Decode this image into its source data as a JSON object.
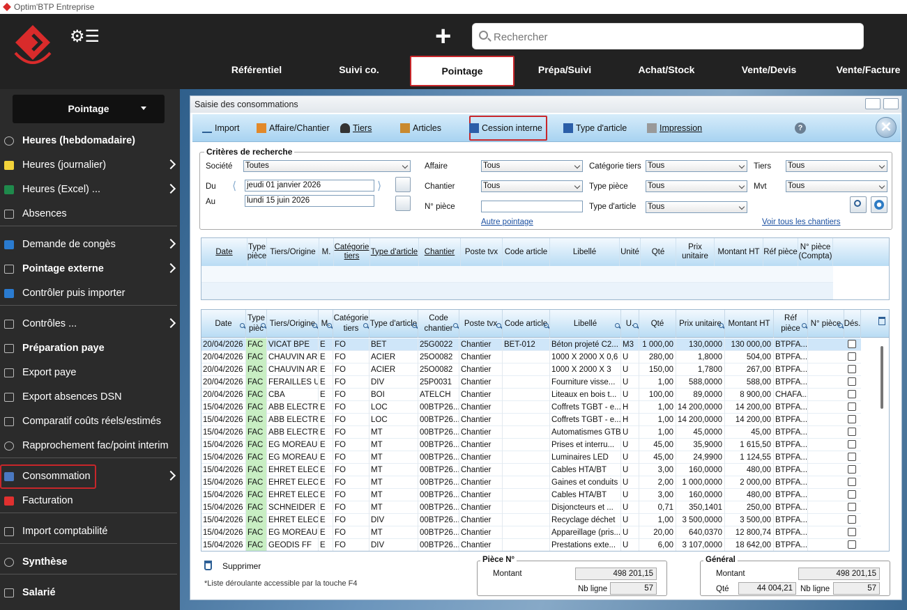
{
  "app_title": "Optim'BTP Entreprise",
  "search": {
    "placeholder": "Rechercher"
  },
  "nav": [
    "Référentiel",
    "Suivi co.",
    "Pointage",
    "Prépa/Suivi",
    "Achat/Stock",
    "Vente/Devis",
    "Vente/Facture"
  ],
  "nav_active": "Pointage",
  "sidebar": {
    "selector": "Pointage",
    "items": [
      {
        "label": "Heures (hebdomadaire)",
        "bold": true,
        "arrow": false,
        "icon": "clock-icon"
      },
      {
        "label": "Heures (journalier)",
        "bold": false,
        "arrow": true,
        "icon": "calendar-yellow-icon"
      },
      {
        "label": "Heures (Excel) ...",
        "bold": false,
        "arrow": true,
        "icon": "excel-icon"
      },
      {
        "label": "Absences",
        "bold": false,
        "arrow": false,
        "icon": "calendar-25-icon"
      },
      {
        "label": "Demande de congès",
        "bold": false,
        "arrow": true,
        "icon": "calendar-blue-icon"
      },
      {
        "label": "Pointage externe",
        "bold": true,
        "arrow": true,
        "icon": "camera-icon"
      },
      {
        "label": "Contrôler puis importer",
        "bold": false,
        "arrow": false,
        "icon": "import-check-icon"
      },
      {
        "label": "Contrôles ...",
        "bold": false,
        "arrow": true,
        "icon": "check-icon"
      },
      {
        "label": "Préparation paye",
        "bold": true,
        "arrow": false,
        "icon": "document-icon"
      },
      {
        "label": "Export paye",
        "bold": false,
        "arrow": false,
        "icon": "book-icon"
      },
      {
        "label": "Export absences DSN",
        "bold": false,
        "arrow": false,
        "icon": "book-icon"
      },
      {
        "label": "Comparatif coûts réels/estimés",
        "bold": false,
        "arrow": false,
        "icon": "grid-icon"
      },
      {
        "label": "Rapprochement fac/point interim",
        "bold": false,
        "arrow": false,
        "icon": "circle-icon"
      },
      {
        "label": "Consommation",
        "bold": false,
        "arrow": true,
        "icon": "box-blue-icon"
      },
      {
        "label": "Facturation",
        "bold": false,
        "arrow": false,
        "icon": "box-red-icon"
      },
      {
        "label": "Import comptabilité",
        "bold": false,
        "arrow": false,
        "icon": "download-icon"
      },
      {
        "label": "Synthèse",
        "bold": true,
        "arrow": false,
        "icon": "pie-chart-icon"
      },
      {
        "label": "Salarié",
        "bold": true,
        "arrow": false,
        "icon": "person-icon"
      }
    ]
  },
  "window": {
    "title": "Saisie des consommations",
    "toolbar": [
      "Import",
      "Affaire/Chantier",
      "Tiers",
      "Articles",
      "Cession interne",
      "Type d'article",
      "Impression"
    ]
  },
  "criteria": {
    "legend": "Critères de recherche",
    "societe_label": "Société",
    "societe": "Toutes",
    "du_label": "Du",
    "du": "jeudi 01 janvier 2026",
    "au_label": "Au",
    "au": "lundi 15 juin 2026",
    "affaire_label": "Affaire",
    "affaire": "Tous",
    "chantier_label": "Chantier",
    "chantier": "Tous",
    "npiece_label": "N° pièce",
    "npiece": "",
    "cattiers_label": "Catégorie tiers",
    "cattiers": "Tous",
    "typepiece_label": "Type pièce",
    "typepiece": "Tous",
    "typearticle_label": "Type d'article",
    "typearticle": "Tous",
    "tiers_label": "Tiers",
    "tiers": "Tous",
    "mvt_label": "Mvt",
    "mvt": "Tous",
    "autre_pointage": "Autre pointage",
    "voir_chantiers": "Voir tous les chantiers"
  },
  "grid1_headers": [
    "Date",
    "Type pièce",
    "Tiers/Origine",
    "M.",
    "Catégorie tiers",
    "Type d'article",
    "Chantier",
    "Poste tvx",
    "Code article",
    "Libellé",
    "Unité",
    "Qté",
    "Prix unitaire",
    "Montant HT",
    "Réf pièce",
    "N° pièce (Compta)"
  ],
  "grid2_headers": [
    "Date",
    "Type pièc",
    "Tiers/Origine",
    "M.",
    "Catégorie tiers",
    "Type d'article",
    "Code chantier",
    "Poste tvx",
    "Code article",
    "Libellé",
    "U.",
    "Qté",
    "Prix unitaire",
    "Montant HT",
    "Réf pièce",
    "N° pièce",
    "Dés."
  ],
  "rows": [
    [
      "20/04/2026",
      "FAC",
      "VICAT BPE",
      "E",
      "FO",
      "BET",
      "25G0022",
      "Chantier",
      "BET-012",
      "Béton projeté C2...",
      "M3",
      "1 000,00",
      "130,0000",
      "130 000,00",
      "BTPFA..."
    ],
    [
      "20/04/2026",
      "FAC",
      "CHAUVIN AR...",
      "E",
      "FO",
      "ACIER",
      "25O0082",
      "Chantier",
      "",
      "1000 X 2000 X 0,6",
      "U",
      "280,00",
      "1,8000",
      "504,00",
      "BTPFA..."
    ],
    [
      "20/04/2026",
      "FAC",
      "CHAUVIN AR...",
      "E",
      "FO",
      "ACIER",
      "25O0082",
      "Chantier",
      "",
      "1000 X 2000 X 3",
      "U",
      "150,00",
      "1,7800",
      "267,00",
      "BTPFA..."
    ],
    [
      "20/04/2026",
      "FAC",
      "FERAILLES UC",
      "E",
      "FO",
      "DIV",
      "25P0031",
      "Chantier",
      "",
      "Fourniture visse...",
      "U",
      "1,00",
      "588,0000",
      "588,00",
      "BTPFA..."
    ],
    [
      "20/04/2026",
      "FAC",
      "CBA",
      "E",
      "FO",
      "BOI",
      "ATELCH",
      "Chantier",
      "",
      "Liteaux en bois t...",
      "U",
      "100,00",
      "89,0000",
      "8 900,00",
      "CHAFA..."
    ],
    [
      "15/04/2026",
      "FAC",
      "ABB ELECTR...",
      "E",
      "FO",
      "LOC",
      "00BTP26...",
      "Chantier",
      "",
      "Coffrets TGBT - e...",
      "H",
      "1,00",
      "14 200,0000",
      "14 200,00",
      "BTPFA..."
    ],
    [
      "15/04/2026",
      "FAC",
      "ABB ELECTR...",
      "E",
      "FO",
      "LOC",
      "00BTP26...",
      "Chantier",
      "",
      "Coffrets TGBT - e...",
      "H",
      "1,00",
      "14 200,0000",
      "14 200,00",
      "BTPFA..."
    ],
    [
      "15/04/2026",
      "FAC",
      "ABB ELECTR...",
      "E",
      "FO",
      "MT",
      "00BTP26...",
      "Chantier",
      "",
      "Automatismes GTB",
      "U",
      "1,00",
      "45,0000",
      "45,00",
      "BTPFA..."
    ],
    [
      "15/04/2026",
      "FAC",
      "EG MOREAU",
      "E",
      "FO",
      "MT",
      "00BTP26...",
      "Chantier",
      "",
      "Prises et interru...",
      "U",
      "45,00",
      "35,9000",
      "1 615,50",
      "BTPFA..."
    ],
    [
      "15/04/2026",
      "FAC",
      "EG MOREAU",
      "E",
      "FO",
      "MT",
      "00BTP26...",
      "Chantier",
      "",
      "Luminaires LED",
      "U",
      "45,00",
      "24,9900",
      "1 124,55",
      "BTPFA..."
    ],
    [
      "15/04/2026",
      "FAC",
      "EHRET ELEC",
      "E",
      "FO",
      "MT",
      "00BTP26...",
      "Chantier",
      "",
      "Cables HTA/BT",
      "U",
      "3,00",
      "160,0000",
      "480,00",
      "BTPFA..."
    ],
    [
      "15/04/2026",
      "FAC",
      "EHRET ELEC",
      "E",
      "FO",
      "MT",
      "00BTP26...",
      "Chantier",
      "",
      "Gaines et conduits",
      "U",
      "2,00",
      "1 000,0000",
      "2 000,00",
      "BTPFA..."
    ],
    [
      "15/04/2026",
      "FAC",
      "EHRET ELEC",
      "E",
      "FO",
      "MT",
      "00BTP26...",
      "Chantier",
      "",
      "Cables HTA/BT",
      "U",
      "3,00",
      "160,0000",
      "480,00",
      "BTPFA..."
    ],
    [
      "15/04/2026",
      "FAC",
      "SCHNEIDER ...",
      "E",
      "FO",
      "MT",
      "00BTP26...",
      "Chantier",
      "",
      "Disjoncteurs et ...",
      "U",
      "0,71",
      "350,1401",
      "250,00",
      "BTPFA..."
    ],
    [
      "15/04/2026",
      "FAC",
      "EHRET ELEC",
      "E",
      "FO",
      "DIV",
      "00BTP26...",
      "Chantier",
      "",
      "Recyclage déchet",
      "U",
      "1,00",
      "3 500,0000",
      "3 500,00",
      "BTPFA..."
    ],
    [
      "15/04/2026",
      "FAC",
      "EG MOREAU",
      "E",
      "FO",
      "MT",
      "00BTP26...",
      "Chantier",
      "",
      "Appareillage (pris...",
      "U",
      "20,00",
      "640,0370",
      "12 800,74",
      "BTPFA..."
    ],
    [
      "15/04/2026",
      "FAC",
      "GEODIS FF",
      "E",
      "FO",
      "DIV",
      "00BTP26...",
      "Chantier",
      "",
      "Prestations exte...",
      "U",
      "6,00",
      "3 107,0000",
      "18 642,00",
      "BTPFA..."
    ]
  ],
  "footer": {
    "supprimer": "Supprimer",
    "note": "*Liste déroulante accessible par la touche F4",
    "piece_legend": "Pièce N°",
    "general_legend": "Général",
    "montant_label": "Montant",
    "nbligne_label": "Nb ligne",
    "qte_label": "Qté",
    "piece_montant": "498 201,15",
    "piece_nbligne": "57",
    "gen_montant": "498 201,15",
    "gen_qte": "44 004,21",
    "gen_nbligne": "57"
  }
}
